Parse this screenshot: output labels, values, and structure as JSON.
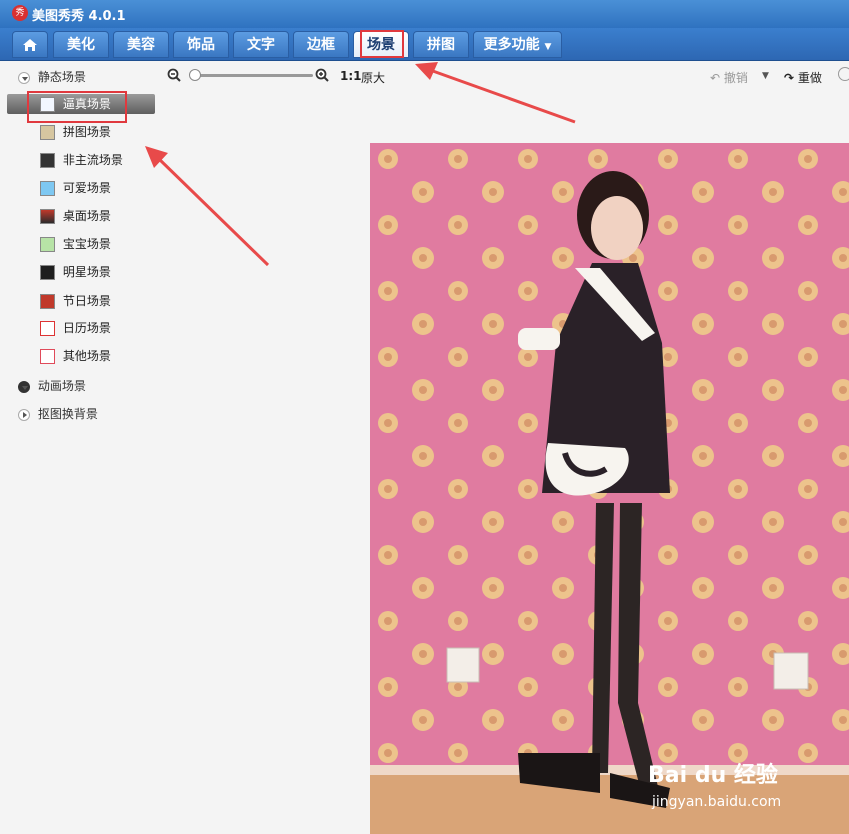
{
  "window": {
    "app_icon_text": "秀",
    "title": "美图秀秀 4.0.1"
  },
  "tabs": [
    "美化",
    "美容",
    "饰品",
    "文字",
    "边框",
    "场景",
    "拼图",
    "更多功能"
  ],
  "active_tab": "场景",
  "sidebar": {
    "group_static": "静态场景",
    "items": [
      "逼真场景",
      "拼图场景",
      "非主流场景",
      "可爱场景",
      "桌面场景",
      "宝宝场景",
      "明星场景",
      "节日场景",
      "日历场景",
      "其他场景"
    ],
    "selected_item": "逼真场景",
    "group_animated": "动画场景",
    "group_cutout": "抠图换背景"
  },
  "toolbar": {
    "ratio": "1:1",
    "original_size": "原大",
    "undo": "撤销",
    "redo": "重做"
  },
  "watermark": {
    "brand": "Bai du 经验",
    "url": "jingyan.baidu.com"
  },
  "colors": {
    "title_bar": "#3b80cf",
    "highlight": "#e0393e",
    "annotation_arrow": "#e84a4a"
  }
}
